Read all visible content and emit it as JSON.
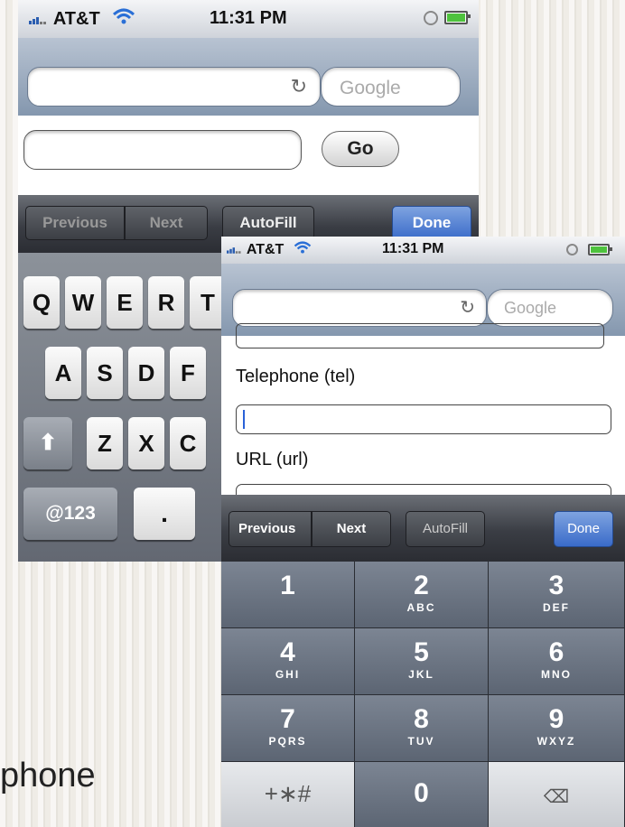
{
  "phone1": {
    "status": {
      "carrier": "AT&T",
      "time": "11:31 PM"
    },
    "url_bar": {
      "url_value": "",
      "search_placeholder": "Google"
    },
    "page": {
      "input_value": "",
      "go_label": "Go"
    },
    "form_toolbar": {
      "previous": "Previous",
      "next": "Next",
      "autofill": "AutoFill",
      "done": "Done"
    },
    "keyboard": {
      "row1": [
        "Q",
        "W",
        "E",
        "R",
        "T"
      ],
      "row2": [
        "A",
        "S",
        "D",
        "F"
      ],
      "row3": [
        "Z",
        "X",
        "C"
      ],
      "mode_key": "@123",
      "period_key": "."
    }
  },
  "phone2": {
    "status": {
      "carrier": "AT&T",
      "time": "11:31 PM"
    },
    "url_bar": {
      "url_value": "",
      "search_placeholder": "Google"
    },
    "form": {
      "telephone_label": "Telephone (tel)",
      "telephone_value": "",
      "url_label": "URL (url)",
      "url_value": ""
    },
    "form_toolbar": {
      "previous": "Previous",
      "next": "Next",
      "autofill": "AutoFill",
      "done": "Done"
    },
    "keypad": [
      {
        "digit": "1",
        "letters": ""
      },
      {
        "digit": "2",
        "letters": "ABC"
      },
      {
        "digit": "3",
        "letters": "DEF"
      },
      {
        "digit": "4",
        "letters": "GHI"
      },
      {
        "digit": "5",
        "letters": "JKL"
      },
      {
        "digit": "6",
        "letters": "MNO"
      },
      {
        "digit": "7",
        "letters": "PQRS"
      },
      {
        "digit": "8",
        "letters": "TUV"
      },
      {
        "digit": "9",
        "letters": "WXYZ"
      },
      {
        "digit": "+∗#",
        "letters": ""
      },
      {
        "digit": "0",
        "letters": ""
      },
      {
        "digit": "⌫",
        "letters": ""
      }
    ]
  },
  "caption": "phone",
  "colors": {
    "done_blue": "#3a6bc9",
    "battery_green": "#4ec23d",
    "caret_blue": "#2a62d8"
  }
}
